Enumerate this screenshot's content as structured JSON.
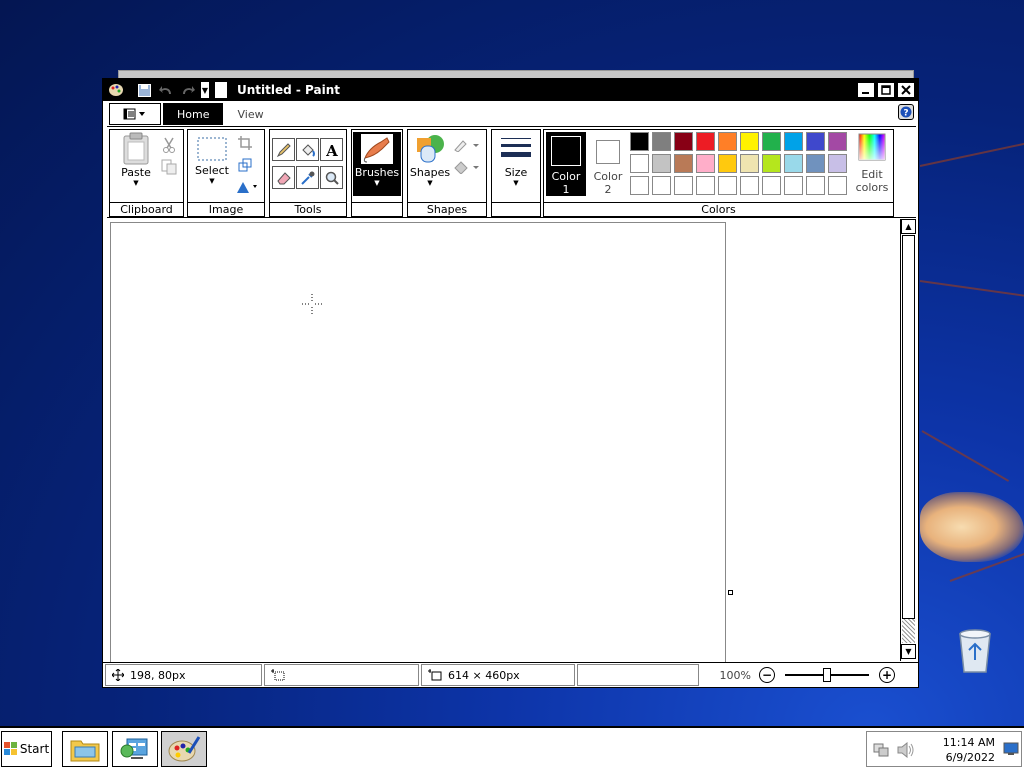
{
  "window": {
    "title": "Untitled - Paint"
  },
  "tabs": {
    "home": "Home",
    "view": "View"
  },
  "ribbon": {
    "clipboard": {
      "paste": "Paste",
      "label": "Clipboard"
    },
    "image": {
      "select": "Select",
      "label": "Image"
    },
    "tools": {
      "label": "Tools"
    },
    "brushes": {
      "label": "Brushes"
    },
    "shapes": {
      "shapes": "Shapes",
      "label": "Shapes"
    },
    "size": {
      "label": "Size"
    },
    "colors": {
      "color1_a": "Color",
      "color1_b": "1",
      "color2_a": "Color",
      "color2_b": "2",
      "edit_a": "Edit",
      "edit_b": "colors",
      "label": "Colors",
      "color1_value": "#000000",
      "color2_value": "#ffffff",
      "palette_row1": [
        "#000000",
        "#7f7f7f",
        "#880015",
        "#ed1c24",
        "#ff7f27",
        "#fff200",
        "#22b14c",
        "#00a2e8",
        "#3f48cc",
        "#a349a4"
      ],
      "palette_row2": [
        "#ffffff",
        "#c3c3c3",
        "#b97a57",
        "#ffaec9",
        "#ffc90e",
        "#efe4b0",
        "#b5e61d",
        "#99d9ea",
        "#7092be",
        "#c8bfe7"
      ],
      "palette_row3": [
        "#ffffff",
        "#ffffff",
        "#ffffff",
        "#ffffff",
        "#ffffff",
        "#ffffff",
        "#ffffff",
        "#ffffff",
        "#ffffff",
        "#ffffff"
      ]
    }
  },
  "status": {
    "cursor_pos": "198, 80px",
    "canvas_size": "614 × 460px",
    "zoom": "100%"
  },
  "taskbar": {
    "start": "Start",
    "time": "11:14 AM",
    "date": "6/9/2022"
  }
}
